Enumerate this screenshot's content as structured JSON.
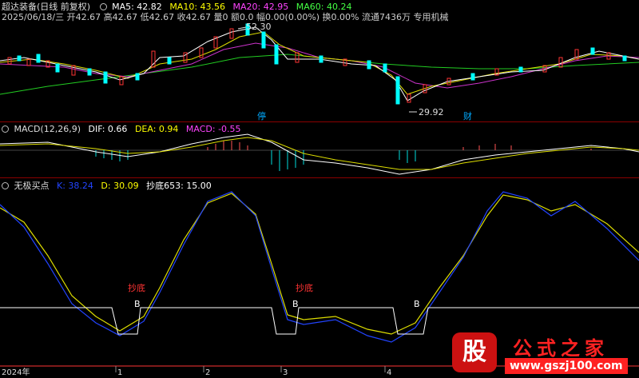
{
  "header": {
    "title": "超达装备(日线 前复权)",
    "ma5": "MA5: 42.82",
    "ma10": "MA10: 43.56",
    "ma20": "MA20: 42.95",
    "ma60": "MA60: 40.24",
    "info": "2025/06/18/三 开42.67 高42.67 低42.67 收42.67 量0 额0.0 幅0.00(0.00%) 换0.00% 流通7436万 专用机械"
  },
  "price": {
    "high_label": "52.30",
    "low_label": "29.92",
    "marker_stop": "停",
    "marker_cai": "财"
  },
  "macd": {
    "title": "MACD(12,26,9)",
    "dif": "DIF: 0.66",
    "dea": "DEA: 0.94",
    "macd": "MACD: -0.55"
  },
  "indicator": {
    "title": "无极买点",
    "k": "K: 38.24",
    "d": "D: 30.09",
    "chaodi": "抄底653: 15.00",
    "signal_label": "抄底",
    "buy_label": "B"
  },
  "axis": {
    "year": "2024年",
    "months": [
      "1",
      "2",
      "3",
      "4"
    ]
  },
  "watermark": {
    "logo": "股",
    "text": "公式之家",
    "url": "www.gszj100.com"
  },
  "colors": {
    "ma5": "#ffffff",
    "ma10": "#ffff00",
    "ma20": "#ff00ff",
    "ma60": "#00ff00",
    "up": "#ff3333",
    "down": "#00ffff",
    "k": "#0040ff",
    "d": "#ffff00",
    "divider": "#8b0000"
  }
}
